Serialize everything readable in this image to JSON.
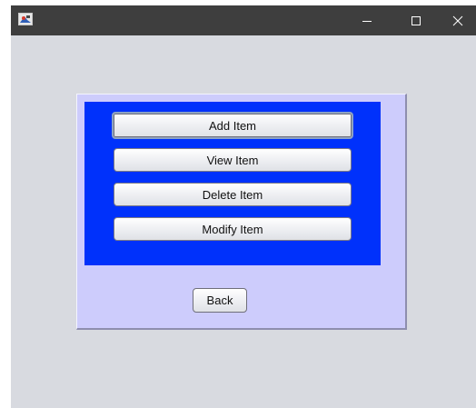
{
  "window": {
    "title_bar_color": "#3e3e3e",
    "background_color": "#d8dae0",
    "controls": {
      "minimize_glyph": "—",
      "maximize_glyph": "☐",
      "close_glyph": "✕"
    }
  },
  "panel": {
    "outer_color": "#cdccfc",
    "inner_color": "#0031fb",
    "buttons": [
      {
        "label": "Add Item"
      },
      {
        "label": "View Item"
      },
      {
        "label": "Delete Item"
      },
      {
        "label": "Modify Item"
      }
    ],
    "back_label": "Back"
  },
  "icons": {
    "app": "java-app-icon",
    "minimize": "minimize-icon",
    "maximize": "maximize-icon",
    "close": "close-icon"
  }
}
